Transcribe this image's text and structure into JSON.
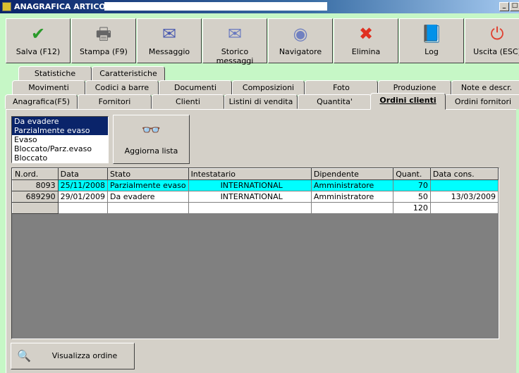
{
  "window": {
    "title": "ANAGRAFICA ARTICOLI -",
    "minimize": "_",
    "maximize": "□"
  },
  "toolbar": [
    {
      "label": "Salva (F12)",
      "icon": "check-icon",
      "glyph": "✔",
      "color": "#2a9a2a"
    },
    {
      "label": "Stampa (F9)",
      "icon": "printer-icon",
      "glyph": "🖶",
      "color": "#666666"
    },
    {
      "label": "Messaggio",
      "icon": "envelope-pen-icon",
      "glyph": "✉",
      "color": "#4a5ab0"
    },
    {
      "label": "Storico messaggi",
      "icon": "envelope-search-icon",
      "glyph": "✉",
      "color": "#6a7ac0"
    },
    {
      "label": "Navigatore",
      "icon": "compass-icon",
      "glyph": "◉",
      "color": "#7080c0"
    },
    {
      "label": "Elimina",
      "icon": "delete-x-icon",
      "glyph": "✖",
      "color": "#e03020"
    },
    {
      "label": "Log",
      "icon": "book-search-icon",
      "glyph": "📘",
      "color": "#2050c0"
    },
    {
      "label": "Uscita (ESC)",
      "icon": "power-icon",
      "glyph": "⏻",
      "color": "#e04030"
    }
  ],
  "tabs": {
    "row1": [
      "Statistiche",
      "Caratteristiche"
    ],
    "row2": [
      "Movimenti",
      "Codici a barre",
      "Documenti",
      "Composizioni",
      "Foto",
      "Produzione",
      "Note e descr."
    ],
    "row3": [
      "Anagrafica(F5)",
      "Fornitori",
      "Clienti",
      "Listini di vendita",
      "Quantita'",
      "Ordini clienti",
      "Ordini fornitori"
    ],
    "selected": "Ordini clienti"
  },
  "status_filter": {
    "options": [
      "Da evadere",
      "Parzialmente evaso",
      "Evaso",
      "Bloccato/Parz.evaso",
      "Bloccato"
    ],
    "selected": [
      "Da evadere",
      "Parzialmente evaso"
    ]
  },
  "refresh_button": {
    "label": "Aggiorna lista",
    "icon": "binoculars-icon"
  },
  "grid": {
    "columns": [
      "N.ord.",
      "Data",
      "Stato",
      "Intestatario",
      "Dipendente",
      "Quant.",
      "Data cons."
    ],
    "rows": [
      [
        "8093",
        "25/11/2008",
        "Parzialmente evaso",
        "INTERNATIONAL",
        "Amministratore",
        "70",
        ""
      ],
      [
        "689290",
        "29/01/2009",
        "Da evadere",
        "INTERNATIONAL",
        "Amministratore",
        "50",
        "13/03/2009"
      ]
    ],
    "total_quantity": "120",
    "highlight_color": "#00ffff"
  },
  "view_order_button": {
    "label": "Visualizza ordine",
    "icon": "document-search-icon"
  }
}
